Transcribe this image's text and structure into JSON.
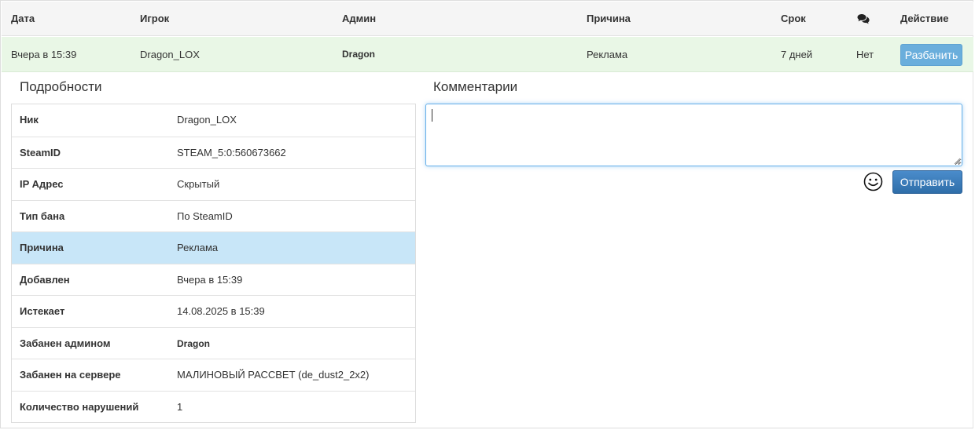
{
  "header": {
    "date": "Дата",
    "player": "Игрок",
    "admin": "Админ",
    "reason": "Причина",
    "term": "Срок",
    "comments_icon": "comments-icon",
    "action": "Действие"
  },
  "ban_row": {
    "date": "Вчера в 15:39",
    "player": "Dragon_LOX",
    "admin": "Dragon",
    "reason": "Реклама",
    "term": "7 дней",
    "comments": "Нет",
    "unban_label": "Разбанить"
  },
  "details": {
    "title": "Подробности",
    "rows": [
      {
        "label": "Ник",
        "value": "Dragon_LOX"
      },
      {
        "label": "SteamID",
        "value": "STEAM_5:0:560673662"
      },
      {
        "label": "IP Адрес",
        "value": "Скрытый"
      },
      {
        "label": "Тип бана",
        "value": "По SteamID"
      },
      {
        "label": "Причина",
        "value": "Реклама"
      },
      {
        "label": "Добавлен",
        "value": "Вчера в 15:39"
      },
      {
        "label": "Истекает",
        "value": "14.08.2025 в 15:39"
      },
      {
        "label": "Забанен админом",
        "value": "Dragon"
      },
      {
        "label": "Забанен на сервере",
        "value": "МАЛИНОВЫЙ РАССВЕТ (de_dust2_2x2)"
      },
      {
        "label": "Количество нарушений",
        "value": "1"
      }
    ],
    "highlighted_row": 4
  },
  "comments": {
    "title": "Комментарии",
    "input_value": "",
    "emoji_icon": "smiley-icon",
    "send_label": "Отправить"
  },
  "colors": {
    "row_success": "#e9f7e6",
    "row_highlight": "#c8e6f8",
    "unban_button": "#6aaedc",
    "send_button": "#337ab7",
    "focus_border": "#66afe9"
  }
}
